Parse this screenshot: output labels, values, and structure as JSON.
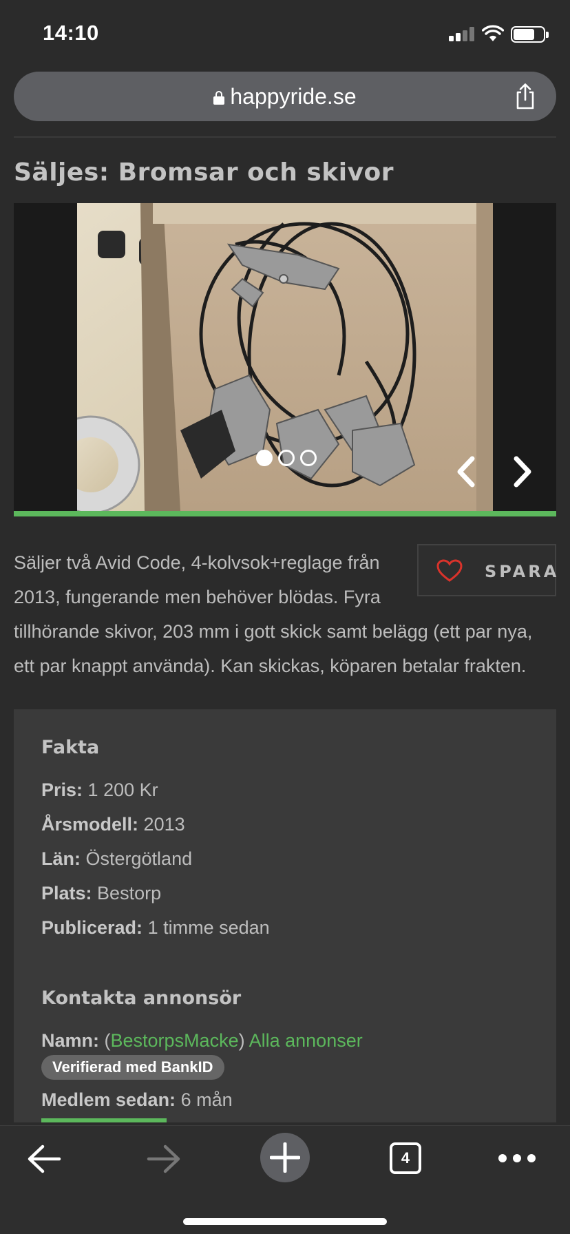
{
  "status_bar": {
    "time": "14:10"
  },
  "browser": {
    "url": "happyride.se",
    "tabs_count": "4"
  },
  "listing": {
    "title": "Säljes: Bromsar och skivor",
    "description": "Säljer två Avid Code, 4-kolvsok+reglage från 2013, fungerande men behöver blödas. Fyra tillhörande skivor, 203 mm i gott skick samt belägg (ett par nya, ett par knappt använda). Kan skickas, köparen betalar frakten.",
    "save_label": "SPARA",
    "gallery": {
      "image_count": 3,
      "active_index": 0
    }
  },
  "facts": {
    "heading": "Fakta",
    "rows": [
      {
        "label": "Pris:",
        "value": "1 200 Kr"
      },
      {
        "label": "Årsmodell:",
        "value": "2013"
      },
      {
        "label": "Län:",
        "value": "Östergötland"
      },
      {
        "label": "Plats:",
        "value": "Bestorp"
      },
      {
        "label": "Publicerad:",
        "value": "1 timme sedan"
      }
    ]
  },
  "contact": {
    "heading": "Kontakta annonsör",
    "name_label": "Namn:",
    "paren_open": " (",
    "username": "BestorpsMacke",
    "paren_close": ") ",
    "all_ads_link": "Alla annonser",
    "verified_badge": "Verifierad med BankID",
    "member_since_label": "Medlem sedan:",
    "member_since_value": "6 mån"
  },
  "colors": {
    "accent_green": "#5cb85c",
    "heart_red": "#d9332b",
    "background": "#2b2b2b",
    "panel": "#3a3a3a"
  }
}
